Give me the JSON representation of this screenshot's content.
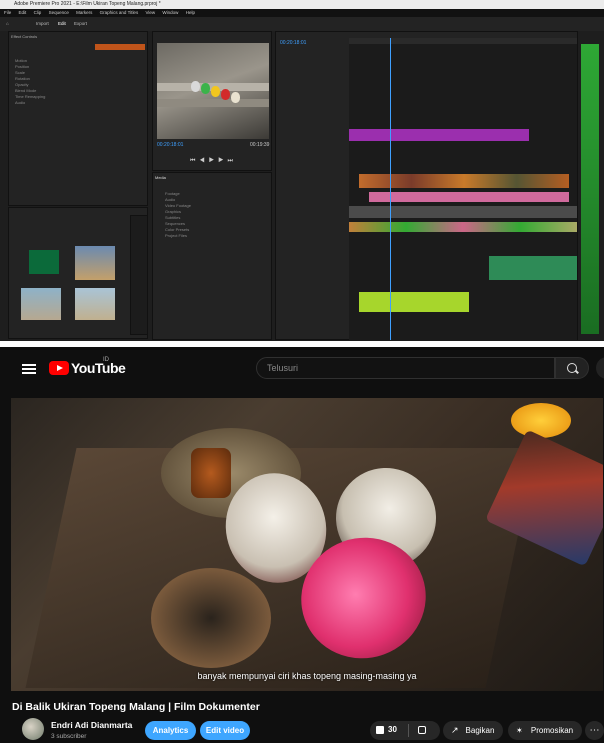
{
  "premiere": {
    "window_title": "Adobe Premiere Pro 2021 - E:\\Film Ukiran Topeng Malang.prproj *",
    "menu": [
      "File",
      "Edit",
      "Clip",
      "Sequence",
      "Markers",
      "Graphics and Titles",
      "View",
      "Window",
      "Help"
    ],
    "workspace_tabs": [
      "Import",
      "Edit",
      "Export"
    ],
    "monitor_timecode": "00:20:18:01",
    "monitor_duration": "00:19:39",
    "sequence_timecode": "00:20:18:01",
    "project_panel_title": "Media",
    "project_items": [
      "Footage",
      "Audio",
      "Video Footage",
      "Graphics",
      "Subtitles",
      "Sequences",
      "Color Presets",
      "Project Files"
    ],
    "effect_panel_label": "Effect Controls",
    "effect_rows": [
      "Motion",
      "Position",
      "Scale",
      "Rotation",
      "Opacity",
      "Blend Mode",
      "Time Remapping",
      "Audio"
    ],
    "colors": {
      "accent": "#3fa0ff",
      "video_clip": "#9b2fae",
      "audio_clip": "#2e8b57",
      "green_clip": "#a7d62c"
    }
  },
  "youtube": {
    "logo_text": "YouTube",
    "country_code": "ID",
    "search_placeholder": "Telusuri",
    "subtitle": "banyak mempunyai ciri khas topeng masing-masing ya",
    "video_title": "Di Balik Ukiran Topeng Malang | Film Dokumenter",
    "channel_name": "Endri Adi Dianmarta",
    "subscriber_count": "3 subscriber",
    "buttons": {
      "analytics": "Analytics",
      "edit_video": "Edit video",
      "share": "Bagikan",
      "promote": "Promosikan"
    },
    "like_count": "30",
    "colors": {
      "brand_red": "#ff0000",
      "action_blue": "#3ea6ff",
      "background": "#0f0f0f"
    }
  }
}
